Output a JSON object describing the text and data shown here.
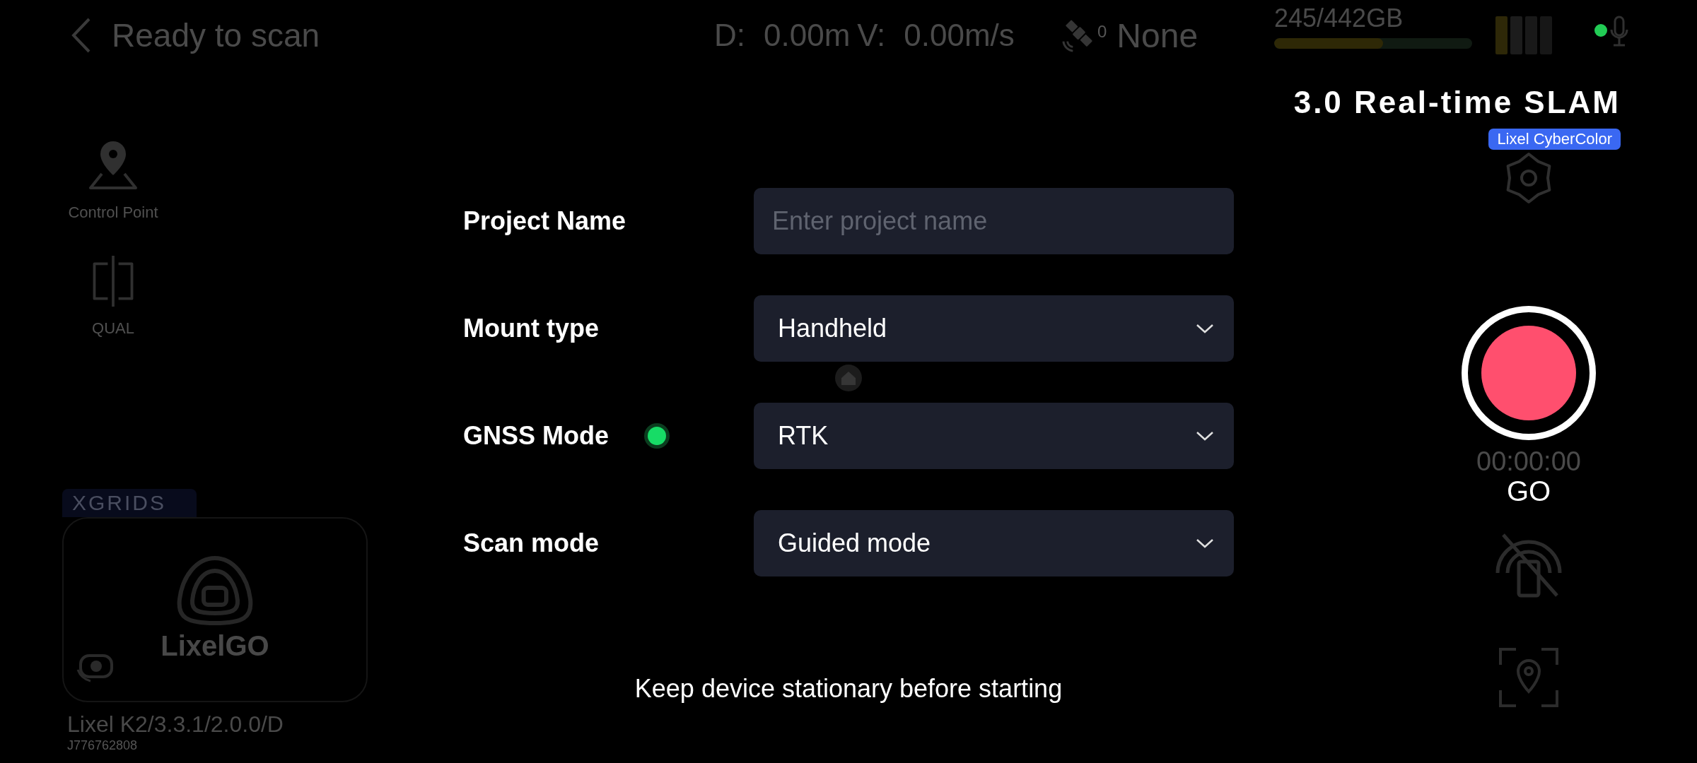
{
  "top_bar": {
    "back_label": "Ready to scan",
    "distance": {
      "label": "D:",
      "value": "0.00m"
    },
    "speed": {
      "label": "V:",
      "value": "0.00m/s"
    },
    "satellites": {
      "count": "0",
      "fix": "None"
    },
    "storage": {
      "text": "245/442GB",
      "level": 0.55
    }
  },
  "mode_banner": {
    "title": "3.0 Real-time SLAM",
    "badge": "Lixel CyberColor"
  },
  "left_tools": [
    {
      "kind": "control_point",
      "label": "Control Point"
    },
    {
      "kind": "qual",
      "label": "QUAL"
    }
  ],
  "device_card": {
    "brand": "XGRIDS",
    "app_logo": "LixelGO",
    "device": "Lixel K2/3.3.1/2.0.0/D",
    "serial": "J776762808"
  },
  "form": {
    "fields": [
      {
        "kind": "input",
        "label": "Project Name",
        "placeholder": "Enter project name"
      },
      {
        "kind": "select",
        "label": "Mount type",
        "value": "Handheld"
      },
      {
        "kind": "select",
        "label": "GNSS Mode",
        "value": "RTK",
        "color": "#17dc66"
      },
      {
        "kind": "select",
        "label": "Scan mode",
        "value": "Guided mode"
      }
    ],
    "hint": "Keep device stationary before starting"
  },
  "record": {
    "timer": "00:00:00",
    "label": "GO"
  }
}
